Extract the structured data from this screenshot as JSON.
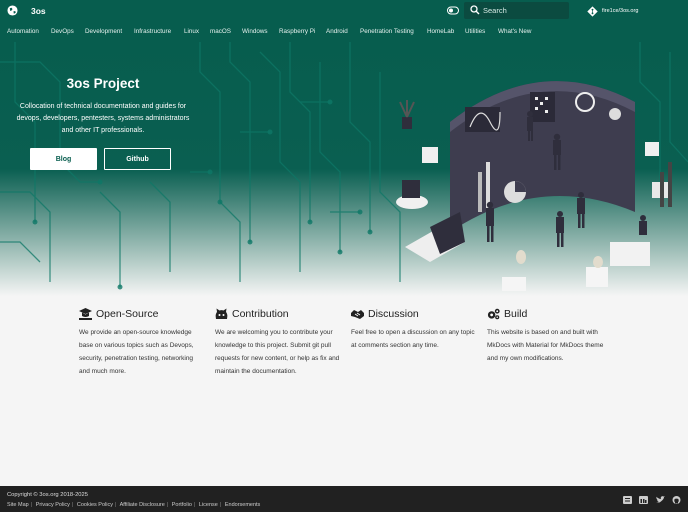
{
  "header": {
    "site_title": "3os",
    "search_placeholder": "Search",
    "repo_label": "fire1ce/3os.org"
  },
  "tabs": [
    "Automation",
    "DevOps",
    "Development",
    "Infrastructure",
    "Linux",
    "macOS",
    "Windows",
    "Raspberry Pi",
    "Android",
    "Penetration Testing",
    "HomeLab",
    "Utilities",
    "What's New"
  ],
  "hero": {
    "title": "3os Project",
    "description": "Collocation of technical documentation and guides for devops, developers, pentesters, systems administrators and other IT professionals.",
    "blog_button": "Blog",
    "github_button": "Github"
  },
  "features": [
    {
      "icon": "teacher-icon",
      "title": "Open-Source",
      "text": "We provide an open-source knowledge base on various topics such as Devops, security, penetration testing, networking and much more."
    },
    {
      "icon": "github-cat-icon",
      "title": "Contribution",
      "text": "We are welcoming you to contribute your knowledge to this project. Submit git pull requests for new content, or help as fix and maintain the documentation."
    },
    {
      "icon": "handshake-icon",
      "title": "Discussion",
      "text": "Feel free to open a discussion on any topic at comments section any time."
    },
    {
      "icon": "gears-icon",
      "title": "Build",
      "text": "This website is based on and built with MkDocs with Material for MkDocs theme and my own modifications."
    }
  ],
  "footer": {
    "copyright": "Copyright © 3os.org 2018-2025",
    "links": [
      "Site Map",
      "Privacy Policy",
      "Cookies Policy",
      "Affiliate Disclosure",
      "Portfolio",
      "License",
      "Endorsements"
    ],
    "social": [
      "rss-icon",
      "linkedin-icon",
      "twitter-icon",
      "github-icon"
    ]
  },
  "colors": {
    "primary": "#075d4e",
    "search_bg": "#0b4b40",
    "footer_bg": "#212121",
    "page_bg": "#f5f5f5"
  }
}
